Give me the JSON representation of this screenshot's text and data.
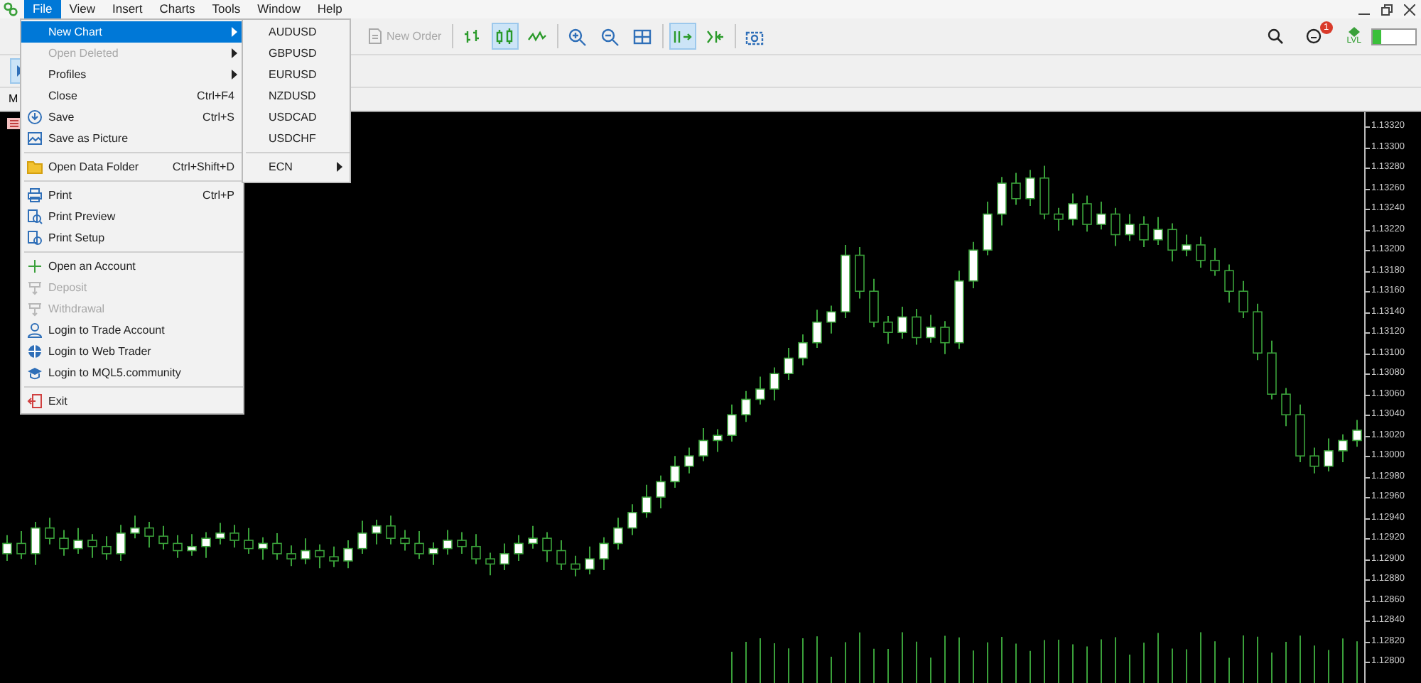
{
  "menu_bar": [
    {
      "label": "File",
      "selected": true
    },
    {
      "label": "View",
      "selected": false
    },
    {
      "label": "Insert",
      "selected": false
    },
    {
      "label": "Charts",
      "selected": false
    },
    {
      "label": "Tools",
      "selected": false
    },
    {
      "label": "Window",
      "selected": false
    },
    {
      "label": "Help",
      "selected": false
    }
  ],
  "toolbar": {
    "new_order": {
      "label": "New Order",
      "disabled": true
    },
    "buttons": [
      {
        "selected": false
      },
      {
        "selected": true
      },
      {
        "selected": false
      },
      {
        "selected": false
      },
      {
        "selected": false
      },
      {
        "selected": false
      },
      {
        "selected": true
      },
      {
        "selected": false
      },
      {
        "selected": false
      }
    ],
    "notification_count": "1",
    "level_label": "LVL",
    "level": 0.2
  },
  "left_tool": {
    "selected": true
  },
  "chart_tab": "M",
  "file_menu": {
    "groups": [
      [
        {
          "label": "New Chart",
          "kind": "submenu",
          "highlighted": true,
          "disabled": false
        },
        {
          "label": "Open Deleted",
          "kind": "submenu",
          "highlighted": false,
          "disabled": true
        },
        {
          "label": "Profiles",
          "kind": "submenu",
          "highlighted": false,
          "disabled": false
        },
        {
          "label": "Close",
          "kind": "item",
          "shortcut": "Ctrl+F4",
          "highlighted": false,
          "disabled": false
        },
        {
          "label": "Save",
          "kind": "item",
          "shortcut": "Ctrl+S",
          "highlighted": false,
          "disabled": false
        },
        {
          "label": "Save as Picture",
          "kind": "item",
          "highlighted": false,
          "disabled": false
        }
      ],
      [
        {
          "label": "Open Data Folder",
          "kind": "item",
          "shortcut": "Ctrl+Shift+D",
          "highlighted": false,
          "disabled": false
        }
      ],
      [
        {
          "label": "Print",
          "kind": "item",
          "shortcut": "Ctrl+P",
          "highlighted": false,
          "disabled": false
        },
        {
          "label": "Print Preview",
          "kind": "item",
          "highlighted": false,
          "disabled": false
        },
        {
          "label": "Print Setup",
          "kind": "item",
          "highlighted": false,
          "disabled": false
        }
      ],
      [
        {
          "label": "Open an Account",
          "kind": "item",
          "highlighted": false,
          "disabled": false
        },
        {
          "label": "Deposit",
          "kind": "item",
          "highlighted": false,
          "disabled": true
        },
        {
          "label": "Withdrawal",
          "kind": "item",
          "highlighted": false,
          "disabled": true
        },
        {
          "label": "Login to Trade Account",
          "kind": "item",
          "highlighted": false,
          "disabled": false
        },
        {
          "label": "Login to Web Trader",
          "kind": "item",
          "highlighted": false,
          "disabled": false
        },
        {
          "label": "Login to MQL5.community",
          "kind": "item",
          "highlighted": false,
          "disabled": false
        }
      ],
      [
        {
          "label": "Exit",
          "kind": "item",
          "highlighted": false,
          "disabled": false
        }
      ]
    ]
  },
  "new_chart_submenu": {
    "groups": [
      [
        {
          "label": "AUDUSD",
          "kind": "item"
        },
        {
          "label": "GBPUSD",
          "kind": "item"
        },
        {
          "label": "EURUSD",
          "kind": "item"
        },
        {
          "label": "NZDUSD",
          "kind": "item"
        },
        {
          "label": "USDCAD",
          "kind": "item"
        },
        {
          "label": "USDCHF",
          "kind": "item"
        }
      ],
      [
        {
          "label": "ECN",
          "kind": "submenu"
        }
      ]
    ]
  },
  "chart": {
    "chart_data": {
      "type": "candlestick",
      "ylim": [
        1.12778,
        1.13334
      ],
      "yticks": [
        {
          "value": 1.1332,
          "label": "1.13320"
        },
        {
          "value": 1.133,
          "label": "1.13300"
        },
        {
          "value": 1.1328,
          "label": "1.13280"
        },
        {
          "value": 1.1326,
          "label": "1.13260"
        },
        {
          "value": 1.1324,
          "label": "1.13240"
        },
        {
          "value": 1.1322,
          "label": "1.13220"
        },
        {
          "value": 1.132,
          "label": "1.13200"
        },
        {
          "value": 1.1318,
          "label": "1.13180"
        },
        {
          "value": 1.1316,
          "label": "1.13160"
        },
        {
          "value": 1.1314,
          "label": "1.13140"
        },
        {
          "value": 1.1312,
          "label": "1.13120"
        },
        {
          "value": 1.131,
          "label": "1.13100"
        },
        {
          "value": 1.1308,
          "label": "1.13080"
        },
        {
          "value": 1.1306,
          "label": "1.13060"
        },
        {
          "value": 1.1304,
          "label": "1.13040"
        },
        {
          "value": 1.1302,
          "label": "1.13020"
        },
        {
          "value": 1.13,
          "label": "1.13000"
        },
        {
          "value": 1.1298,
          "label": "1.12980"
        },
        {
          "value": 1.1296,
          "label": "1.12960"
        },
        {
          "value": 1.1294,
          "label": "1.12940"
        },
        {
          "value": 1.1292,
          "label": "1.12920"
        },
        {
          "value": 1.129,
          "label": "1.12900"
        },
        {
          "value": 1.1288,
          "label": "1.12880"
        },
        {
          "value": 1.1286,
          "label": "1.12860"
        },
        {
          "value": 1.1284,
          "label": "1.12840"
        },
        {
          "value": 1.1282,
          "label": "1.12820"
        },
        {
          "value": 1.128,
          "label": "1.12800"
        }
      ],
      "ohlc": [
        [
          1.12905,
          1.12923,
          1.12898,
          1.12915
        ],
        [
          1.12915,
          1.12927,
          1.129,
          1.12905
        ],
        [
          1.12905,
          1.12936,
          1.12894,
          1.1293
        ],
        [
          1.1293,
          1.1294,
          1.12914,
          1.1292
        ],
        [
          1.1292,
          1.12928,
          1.12903,
          1.1291
        ],
        [
          1.1291,
          1.1293,
          1.12905,
          1.12918
        ],
        [
          1.12918,
          1.12924,
          1.12901,
          1.12912
        ],
        [
          1.12912,
          1.12922,
          1.12899,
          1.12905
        ],
        [
          1.12905,
          1.12933,
          1.12898,
          1.12925
        ],
        [
          1.12925,
          1.12942,
          1.1292,
          1.1293
        ],
        [
          1.1293,
          1.12936,
          1.12911,
          1.12922
        ],
        [
          1.12922,
          1.12932,
          1.12909,
          1.12915
        ],
        [
          1.12915,
          1.12923,
          1.12901,
          1.12908
        ],
        [
          1.12908,
          1.12924,
          1.12903,
          1.12912
        ],
        [
          1.12912,
          1.12926,
          1.12901,
          1.1292
        ],
        [
          1.1292,
          1.12935,
          1.12914,
          1.12925
        ],
        [
          1.12925,
          1.12933,
          1.12911,
          1.12918
        ],
        [
          1.12918,
          1.1293,
          1.12905,
          1.1291
        ],
        [
          1.1291,
          1.12921,
          1.12899,
          1.12915
        ],
        [
          1.12915,
          1.12925,
          1.12899,
          1.12905
        ],
        [
          1.12905,
          1.12913,
          1.12893,
          1.129
        ],
        [
          1.129,
          1.1292,
          1.12895,
          1.12908
        ],
        [
          1.12908,
          1.12914,
          1.12891,
          1.12902
        ],
        [
          1.12902,
          1.12912,
          1.12892,
          1.12898
        ],
        [
          1.12898,
          1.12918,
          1.12891,
          1.1291
        ],
        [
          1.1291,
          1.12937,
          1.12905,
          1.12925
        ],
        [
          1.12925,
          1.12938,
          1.12914,
          1.12932
        ],
        [
          1.12932,
          1.12942,
          1.12914,
          1.1292
        ],
        [
          1.1292,
          1.12928,
          1.12908,
          1.12915
        ],
        [
          1.12915,
          1.12927,
          1.129,
          1.12905
        ],
        [
          1.12905,
          1.12916,
          1.12894,
          1.1291
        ],
        [
          1.1291,
          1.12928,
          1.12904,
          1.12918
        ],
        [
          1.12918,
          1.12926,
          1.12905,
          1.12912
        ],
        [
          1.12912,
          1.12924,
          1.12895,
          1.129
        ],
        [
          1.129,
          1.12906,
          1.12884,
          1.12895
        ],
        [
          1.12895,
          1.12915,
          1.12889,
          1.12905
        ],
        [
          1.12905,
          1.12923,
          1.12898,
          1.12915
        ],
        [
          1.12915,
          1.12932,
          1.1291,
          1.1292
        ],
        [
          1.1292,
          1.12926,
          1.12897,
          1.12908
        ],
        [
          1.12908,
          1.12918,
          1.12889,
          1.12895
        ],
        [
          1.12895,
          1.12903,
          1.12883,
          1.1289
        ],
        [
          1.1289,
          1.12912,
          1.12885,
          1.129
        ],
        [
          1.129,
          1.12921,
          1.12889,
          1.12915
        ],
        [
          1.12915,
          1.1294,
          1.12909,
          1.1293
        ],
        [
          1.1293,
          1.12953,
          1.12923,
          1.12945
        ],
        [
          1.12945,
          1.12972,
          1.1294,
          1.1296
        ],
        [
          1.1296,
          1.12981,
          1.12949,
          1.12975
        ],
        [
          1.12975,
          1.13,
          1.12969,
          1.1299
        ],
        [
          1.1299,
          1.13008,
          1.12983,
          1.13
        ],
        [
          1.13,
          1.13027,
          1.12995,
          1.13015
        ],
        [
          1.13015,
          1.13026,
          1.13004,
          1.1302
        ],
        [
          1.1302,
          1.1305,
          1.13014,
          1.1304
        ],
        [
          1.1304,
          1.13063,
          1.13033,
          1.13055
        ],
        [
          1.13055,
          1.13077,
          1.1305,
          1.13065
        ],
        [
          1.13065,
          1.13086,
          1.13054,
          1.1308
        ],
        [
          1.1308,
          1.13105,
          1.13074,
          1.13095
        ],
        [
          1.13095,
          1.13118,
          1.13088,
          1.1311
        ],
        [
          1.1311,
          1.13142,
          1.13105,
          1.1313
        ],
        [
          1.1313,
          1.13146,
          1.13119,
          1.1314
        ],
        [
          1.1314,
          1.13205,
          1.13134,
          1.13195
        ],
        [
          1.13195,
          1.13203,
          1.13153,
          1.1316
        ],
        [
          1.1316,
          1.13172,
          1.13125,
          1.1313
        ],
        [
          1.1313,
          1.13136,
          1.13109,
          1.1312
        ],
        [
          1.1312,
          1.13145,
          1.13114,
          1.13135
        ],
        [
          1.13135,
          1.13143,
          1.13108,
          1.13115
        ],
        [
          1.13115,
          1.13137,
          1.1311,
          1.13125
        ],
        [
          1.13125,
          1.13131,
          1.13099,
          1.1311
        ],
        [
          1.1311,
          1.1318,
          1.13104,
          1.1317
        ],
        [
          1.1317,
          1.13208,
          1.13163,
          1.132
        ],
        [
          1.132,
          1.13247,
          1.13195,
          1.13235
        ],
        [
          1.13235,
          1.13271,
          1.13224,
          1.13265
        ],
        [
          1.13265,
          1.13275,
          1.13244,
          1.1325
        ],
        [
          1.1325,
          1.13278,
          1.13243,
          1.1327
        ],
        [
          1.1327,
          1.13282,
          1.1323,
          1.13235
        ],
        [
          1.13235,
          1.13241,
          1.13219,
          1.1323
        ],
        [
          1.1323,
          1.13255,
          1.13224,
          1.13245
        ],
        [
          1.13245,
          1.13253,
          1.13218,
          1.13225
        ],
        [
          1.13225,
          1.13247,
          1.1322,
          1.13235
        ],
        [
          1.13235,
          1.13241,
          1.13204,
          1.13215
        ],
        [
          1.13215,
          1.13235,
          1.13209,
          1.13225
        ],
        [
          1.13225,
          1.13233,
          1.13203,
          1.1321
        ],
        [
          1.1321,
          1.13232,
          1.13205,
          1.1322
        ],
        [
          1.1322,
          1.13226,
          1.13189,
          1.132
        ],
        [
          1.132,
          1.13215,
          1.13194,
          1.13205
        ],
        [
          1.13205,
          1.13213,
          1.13183,
          1.1319
        ],
        [
          1.1319,
          1.13202,
          1.13175,
          1.1318
        ],
        [
          1.1318,
          1.13186,
          1.13149,
          1.1316
        ],
        [
          1.1316,
          1.1317,
          1.13134,
          1.1314
        ],
        [
          1.1314,
          1.13148,
          1.13093,
          1.131
        ],
        [
          1.131,
          1.13112,
          1.13055,
          1.1306
        ],
        [
          1.1306,
          1.13066,
          1.13029,
          1.1304
        ],
        [
          1.1304,
          1.1305,
          1.12994,
          1.13
        ],
        [
          1.13,
          1.13008,
          1.12983,
          1.1299
        ],
        [
          1.1299,
          1.13017,
          1.12985,
          1.13005
        ],
        [
          1.13005,
          1.13021,
          1.12994,
          1.13015
        ],
        [
          1.13015,
          1.13035,
          1.13009,
          1.13025
        ]
      ]
    }
  }
}
